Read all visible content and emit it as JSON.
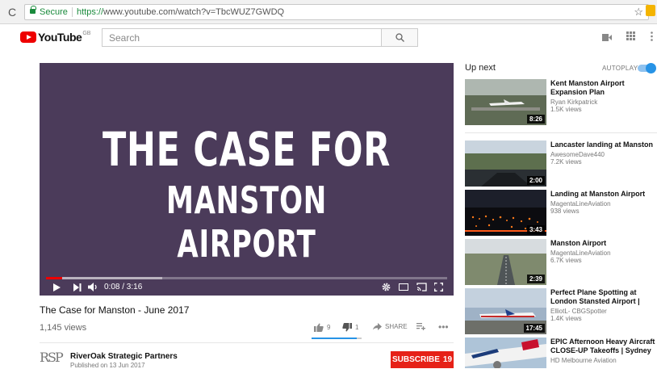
{
  "browser": {
    "reload_icon": "reload-icon",
    "secure_label": "Secure",
    "url_proto": "https://",
    "url_rest": "www.youtube.com/watch?v=TbcWUZ7GWDQ"
  },
  "header": {
    "logo_text": "YouTube",
    "region": "GB",
    "search_placeholder": "Search"
  },
  "player": {
    "overlay_line1": "THE CASE FOR",
    "overlay_line2": "MANSTON AIRPORT",
    "time": "0:08 / 3:16",
    "progress_fraction": 0.04,
    "buffer_fraction": 0.29,
    "bg_color": "#4b3b5a"
  },
  "video": {
    "title": "The Case for Manston - June 2017",
    "views": "1,145 views",
    "likes": "9",
    "dislikes": "1",
    "share_label": "SHARE",
    "like_fraction": 0.9
  },
  "channel": {
    "logo_text": "RSP",
    "name": "RiverOak Strategic Partners",
    "published": "Published on 13 Jun 2017",
    "subscribe_label": "SUBSCRIBE",
    "subscriber_count": "19"
  },
  "sidebar": {
    "upnext_label": "Up next",
    "autoplay_label": "AUTOPLAY",
    "items": [
      {
        "title": "Kent Manston Airport Expansion Plan",
        "channel": "Ryan Kirkpatrick",
        "views": "1.5K views",
        "duration": "8:26"
      },
      {
        "title": "Lancaster landing at Manston",
        "channel": "AwesomeDave440",
        "views": "7.2K views",
        "duration": "2:00"
      },
      {
        "title": "Landing at Manston Airport",
        "channel": "MagentaLineAviation",
        "views": "938 views",
        "duration": "3:43"
      },
      {
        "title": "Manston Airport",
        "channel": "MagentaLineAviation",
        "views": "6.7K views",
        "duration": "2:39"
      },
      {
        "title": "Perfect Plane Spotting at London Stansted Airport |",
        "channel": "ElliotL- CBGSpotter",
        "views": "1.4K views",
        "duration": "17:45"
      },
      {
        "title": "EPIC Afternoon Heavy Aircraft CLOSE-UP Takeoffs | Sydney",
        "channel": "HD Melbourne Aviation",
        "views": "",
        "duration": ""
      }
    ]
  },
  "colors": {
    "brand_red": "#e62117",
    "accent_blue": "#2793e6"
  }
}
